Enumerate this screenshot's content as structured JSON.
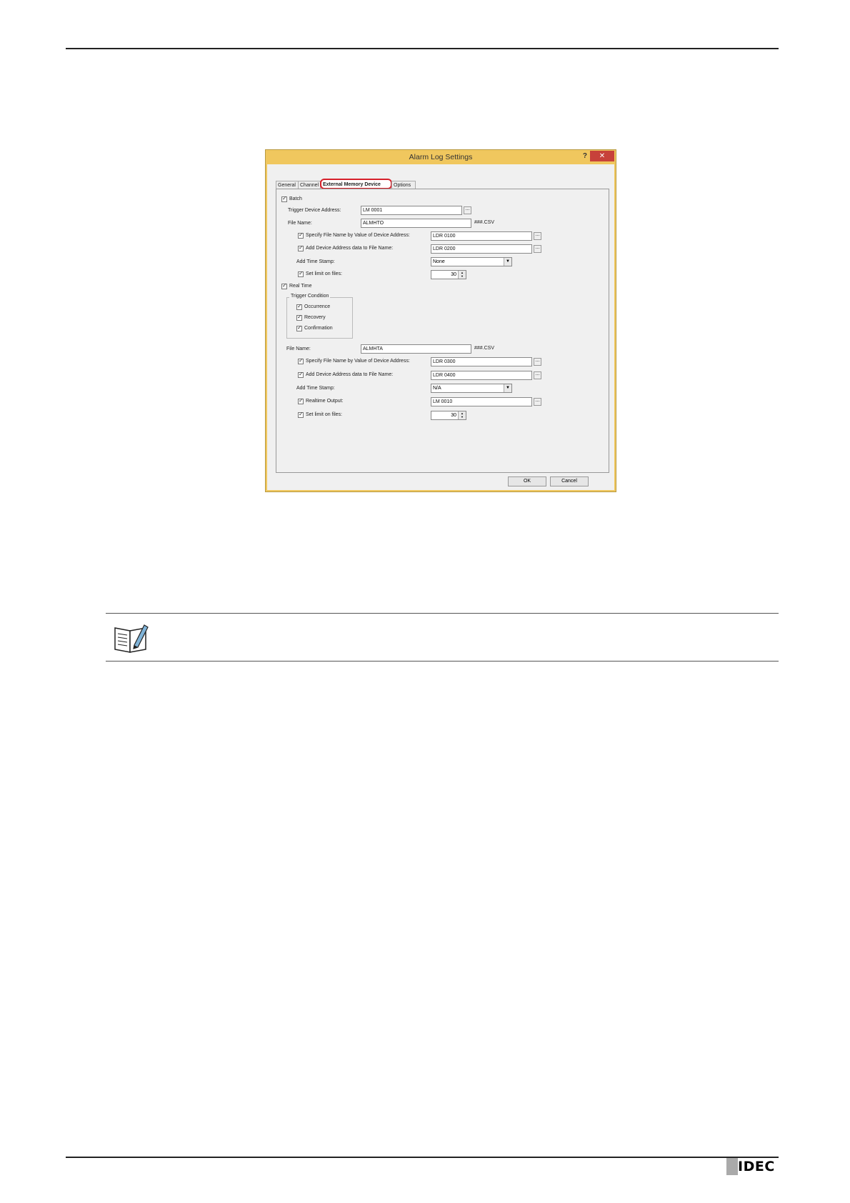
{
  "dialog": {
    "title": "Alarm Log Settings",
    "help": "?",
    "close": "✕",
    "tabs": [
      "General",
      "Channel",
      "External Memory Device",
      "Options"
    ],
    "active_tab": "External Memory Device",
    "batch": {
      "label": "Batch",
      "checked": true,
      "trigger_label": "Trigger Device Address:",
      "trigger_value": "LM 0001",
      "file_name_label": "File Name:",
      "file_name_value": "ALMHTO",
      "ext": "###.CSV",
      "specify_label": "Specify File Name by Value of Device Address:",
      "specify_value": "LDR 0100",
      "add_device_label": "Add Device Address data to File Name:",
      "add_device_value": "LDR 0200",
      "time_stamp_label": "Add Time Stamp:",
      "time_stamp_value": "None",
      "set_limit_label": "Set limit on files:",
      "set_limit_value": "30"
    },
    "realtime": {
      "label": "Real Time",
      "checked": true,
      "trigger_condition_label": "Trigger Condition",
      "occurrence_label": "Occurrence",
      "recovery_label": "Recovery",
      "confirmation_label": "Confirmation",
      "file_name_label": "File Name:",
      "file_name_value": "ALMHTA",
      "ext": "###.CSV",
      "specify_label": "Specify File Name by Value of Device Address:",
      "specify_value": "LDR 0300",
      "add_device_label": "Add Device Address data to File Name:",
      "add_device_value": "LDR 0400",
      "time_stamp_label": "Add Time Stamp:",
      "time_stamp_value": "N/A",
      "realtime_output_label": "Realtime Output:",
      "realtime_output_value": "LM 0010",
      "set_limit_label": "Set limit on files:",
      "set_limit_value": "30"
    },
    "ok_label": "OK",
    "cancel_label": "Cancel",
    "browse_label": "..."
  },
  "footer": {
    "logo": "IDEC"
  },
  "colors": {
    "window_frame": "#f0c75e",
    "close_button": "#c7413a",
    "tab_highlight": "#d6202a"
  }
}
